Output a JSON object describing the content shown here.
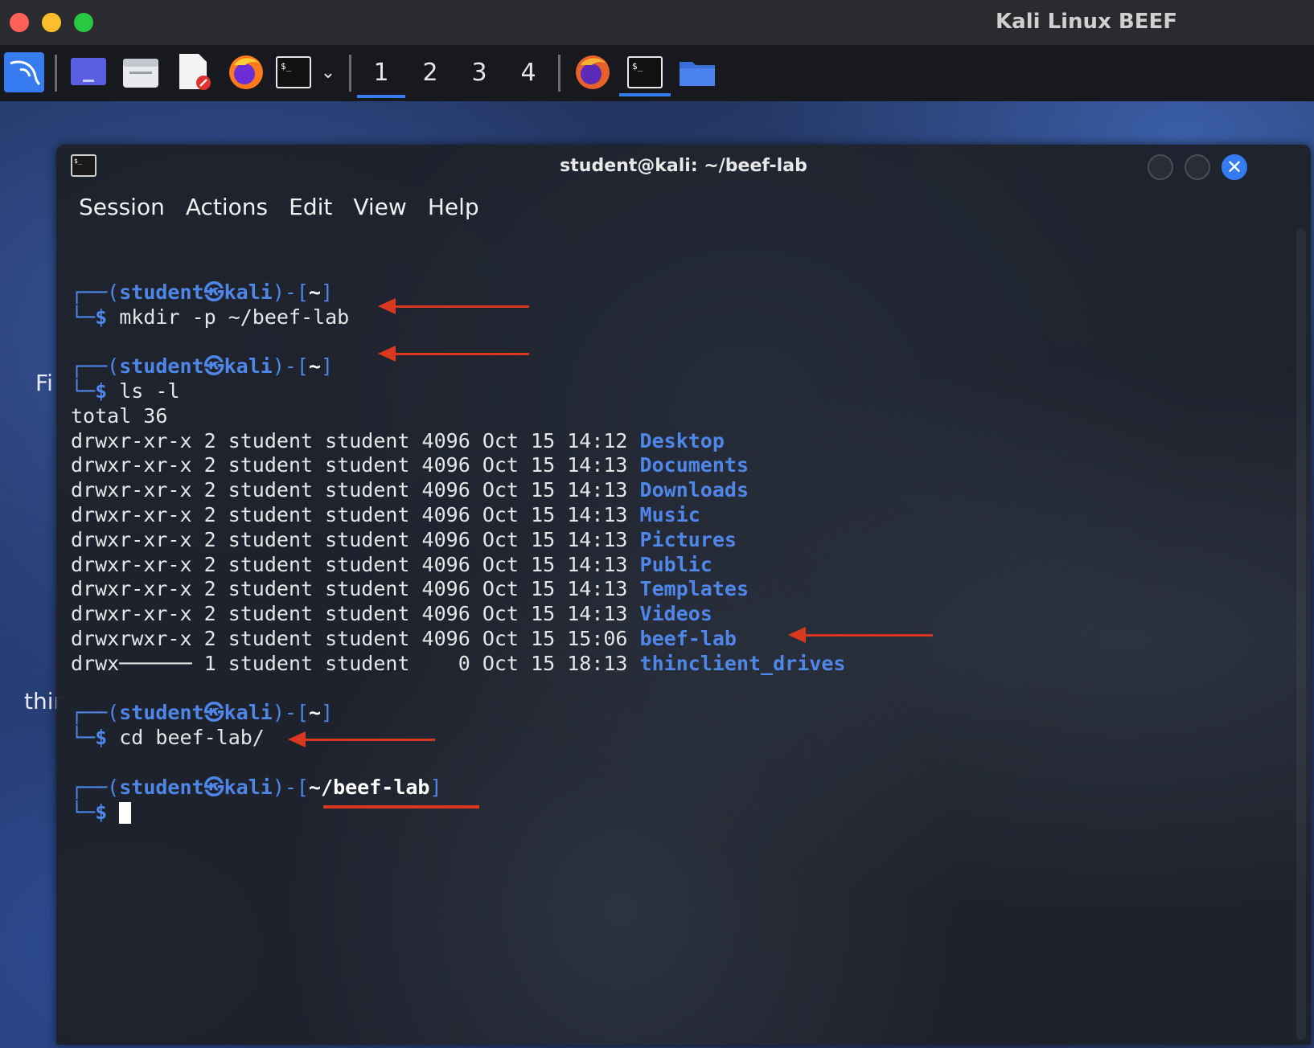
{
  "mac_window": {
    "title": "Kali Linux BEEF"
  },
  "panel": {
    "workspaces": [
      "1",
      "2",
      "3",
      "4"
    ],
    "active_workspace": "1",
    "launchers": [
      "kali-menu-icon",
      "show-desktop-icon",
      "file-manager-icon",
      "text-editor-icon",
      "firefox-icon",
      "terminal-icon",
      "chevron-down-icon"
    ],
    "tasks": [
      "firefox-icon",
      "terminal-icon",
      "folder-icon"
    ]
  },
  "desktop": {
    "labels": [
      "Fi",
      "thir"
    ]
  },
  "terminal": {
    "title": "student@kali: ~/beef-lab",
    "menu": [
      "Session",
      "Actions",
      "Edit",
      "View",
      "Help"
    ],
    "prompt": {
      "user": "student",
      "host": "kali",
      "at_glyph": "㉿"
    },
    "blocks": [
      {
        "dir": "~",
        "command": "mkdir -p ~/beef-lab"
      },
      {
        "dir": "~",
        "command": "ls -l"
      }
    ],
    "ls_total": "total 36",
    "ls_rows": [
      {
        "perm": "drwxr-xr-x",
        "links": "2",
        "owner": "student",
        "group": "student",
        "size": "4096",
        "month": "Oct",
        "day": "15",
        "time": "14:12",
        "name": "Desktop"
      },
      {
        "perm": "drwxr-xr-x",
        "links": "2",
        "owner": "student",
        "group": "student",
        "size": "4096",
        "month": "Oct",
        "day": "15",
        "time": "14:13",
        "name": "Documents"
      },
      {
        "perm": "drwxr-xr-x",
        "links": "2",
        "owner": "student",
        "group": "student",
        "size": "4096",
        "month": "Oct",
        "day": "15",
        "time": "14:13",
        "name": "Downloads"
      },
      {
        "perm": "drwxr-xr-x",
        "links": "2",
        "owner": "student",
        "group": "student",
        "size": "4096",
        "month": "Oct",
        "day": "15",
        "time": "14:13",
        "name": "Music"
      },
      {
        "perm": "drwxr-xr-x",
        "links": "2",
        "owner": "student",
        "group": "student",
        "size": "4096",
        "month": "Oct",
        "day": "15",
        "time": "14:13",
        "name": "Pictures"
      },
      {
        "perm": "drwxr-xr-x",
        "links": "2",
        "owner": "student",
        "group": "student",
        "size": "4096",
        "month": "Oct",
        "day": "15",
        "time": "14:13",
        "name": "Public"
      },
      {
        "perm": "drwxr-xr-x",
        "links": "2",
        "owner": "student",
        "group": "student",
        "size": "4096",
        "month": "Oct",
        "day": "15",
        "time": "14:13",
        "name": "Templates"
      },
      {
        "perm": "drwxr-xr-x",
        "links": "2",
        "owner": "student",
        "group": "student",
        "size": "4096",
        "month": "Oct",
        "day": "15",
        "time": "14:13",
        "name": "Videos"
      },
      {
        "perm": "drwxrwxr-x",
        "links": "2",
        "owner": "student",
        "group": "student",
        "size": "4096",
        "month": "Oct",
        "day": "15",
        "time": "15:06",
        "name": "beef-lab"
      },
      {
        "perm": "drwx──────",
        "links": "1",
        "owner": "student",
        "group": "student",
        "size": "0",
        "month": "Oct",
        "day": "15",
        "time": "18:13",
        "name": "thinclient_drives"
      }
    ],
    "block3": {
      "dir": "~",
      "command": "cd beef-lab/"
    },
    "block4": {
      "dir": "~/beef-lab",
      "command": ""
    },
    "dollar": "$"
  },
  "colors": {
    "accent": "#367bf0",
    "prompt_blue": "#4f87e8",
    "annotation_red": "#d8381e"
  }
}
